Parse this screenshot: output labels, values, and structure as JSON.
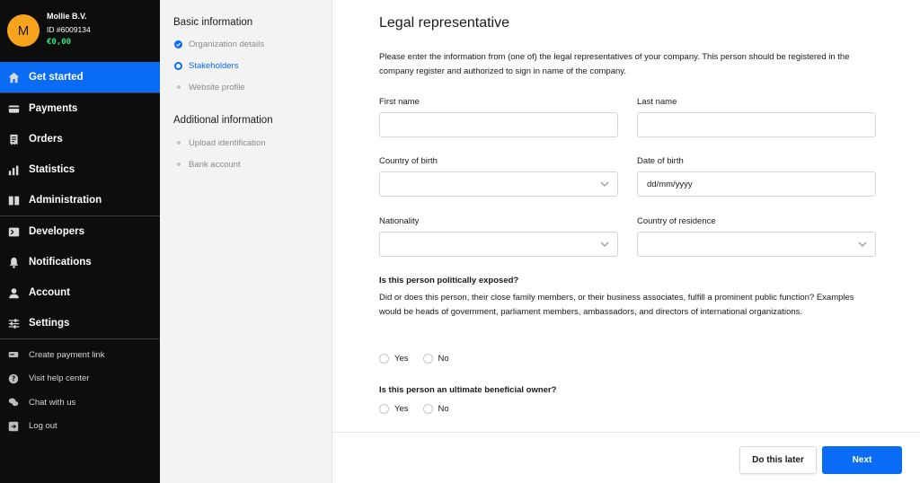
{
  "account": {
    "avatar_letter": "M",
    "name": "Mollie B.V.",
    "id": "ID #6009134",
    "balance": "€0,00"
  },
  "nav": {
    "items": [
      {
        "label": "Get started",
        "icon": "home-icon",
        "active": true
      },
      {
        "label": "Payments",
        "icon": "card-icon"
      },
      {
        "label": "Orders",
        "icon": "receipt-icon"
      },
      {
        "label": "Statistics",
        "icon": "bar-chart-icon"
      },
      {
        "label": "Administration",
        "icon": "book-icon"
      },
      {
        "label": "Developers",
        "icon": "terminal-icon"
      },
      {
        "label": "Notifications",
        "icon": "bell-icon"
      },
      {
        "label": "Account",
        "icon": "user-icon"
      },
      {
        "label": "Settings",
        "icon": "sliders-icon"
      }
    ],
    "secondary": [
      {
        "label": "Create payment link",
        "icon": "link-icon"
      },
      {
        "label": "Visit help center",
        "icon": "help-icon"
      },
      {
        "label": "Chat with us",
        "icon": "chat-icon"
      },
      {
        "label": "Log out",
        "icon": "logout-icon"
      }
    ]
  },
  "steps": {
    "basic_heading": "Basic information",
    "basic": [
      {
        "label": "Organization details",
        "state": "done"
      },
      {
        "label": "Stakeholders",
        "state": "current"
      },
      {
        "label": "Website profile",
        "state": "todo"
      }
    ],
    "additional_heading": "Additional information",
    "additional": [
      {
        "label": "Upload identification",
        "state": "todo"
      },
      {
        "label": "Bank account",
        "state": "todo"
      }
    ]
  },
  "form": {
    "title": "Legal representative",
    "intro": "Please enter the information from (one of) the legal representatives of your company. This person should be registered in the company register and authorized to sign in name of the company.",
    "first_name_label": "First name",
    "last_name_label": "Last name",
    "country_of_birth_label": "Country of birth",
    "date_of_birth_label": "Date of birth",
    "date_of_birth_value": "dd/mm/yyyy",
    "nationality_label": "Nationality",
    "country_of_residence_label": "Country of residence",
    "pep_question": "Is this person politically exposed?",
    "pep_description": "Did or does this person, their close family members, or their business associates, fulfill a prominent public function? Examples would be heads of government, parliament members, ambassadors, and directors of international organizations.",
    "ubo_question": "Is this person an ultimate beneficial owner?",
    "yes_label": "Yes",
    "no_label": "No"
  },
  "footer": {
    "later_label": "Do this later",
    "next_label": "Next"
  },
  "colors": {
    "accent": "#0a6bf5",
    "sidebar_bg": "#0d0d0d",
    "avatar": "#f7a41c",
    "balance": "#2fe37a"
  }
}
